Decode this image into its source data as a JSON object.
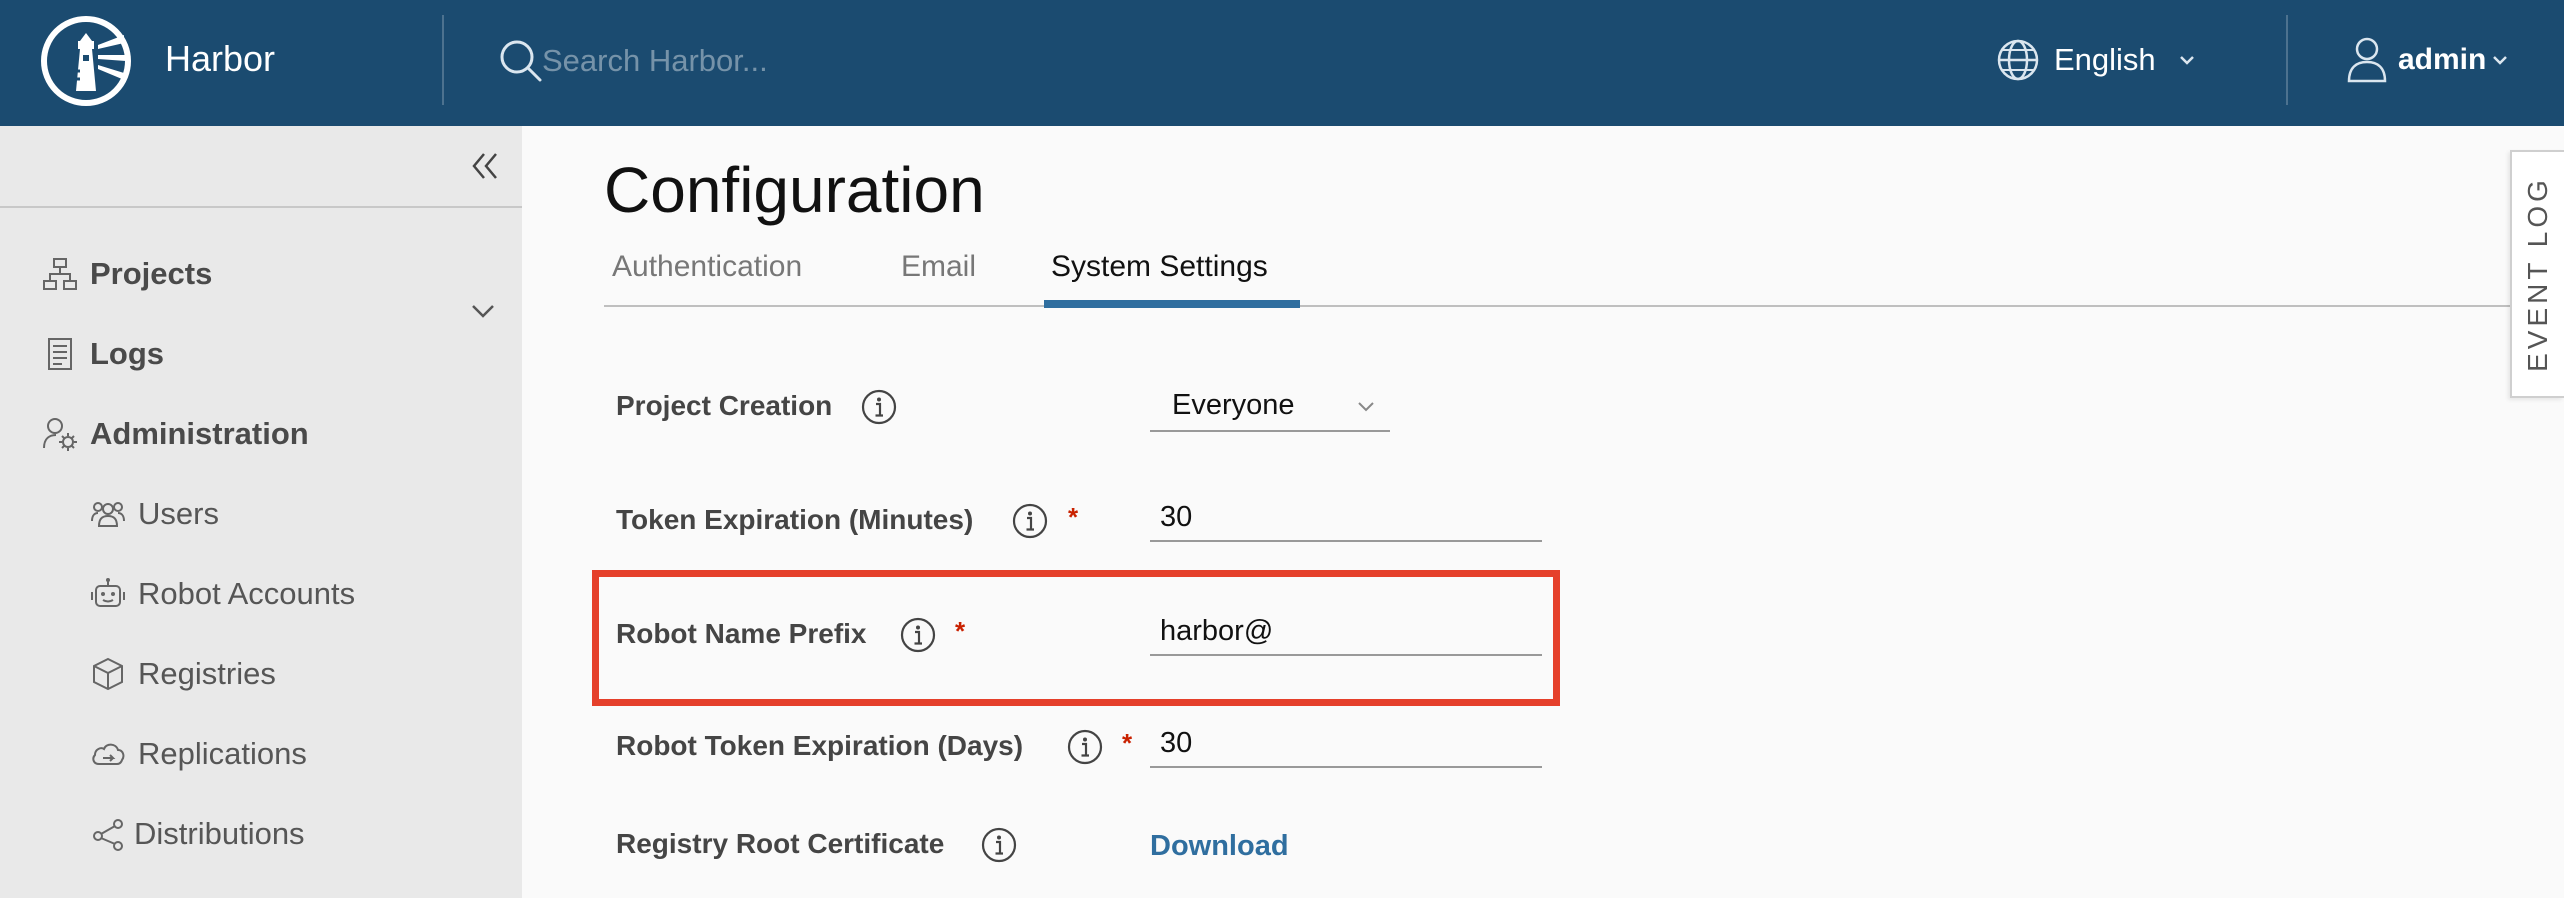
{
  "header": {
    "brand": "Harbor",
    "search_placeholder": "Search Harbor...",
    "language": "English",
    "user": "admin"
  },
  "sidebar": {
    "items": [
      {
        "label": "Projects",
        "icon": "projects-icon"
      },
      {
        "label": "Logs",
        "icon": "logs-icon"
      },
      {
        "label": "Administration",
        "icon": "administration-icon"
      },
      {
        "label": "Users",
        "icon": "users-icon"
      },
      {
        "label": "Robot Accounts",
        "icon": "robot-icon"
      },
      {
        "label": "Registries",
        "icon": "registries-icon"
      },
      {
        "label": "Replications",
        "icon": "replications-icon"
      },
      {
        "label": "Distributions",
        "icon": "distributions-icon"
      }
    ]
  },
  "page": {
    "title": "Configuration",
    "tabs": [
      {
        "label": "Authentication"
      },
      {
        "label": "Email"
      },
      {
        "label": "System Settings",
        "active": true
      }
    ]
  },
  "settings": {
    "project_creation": {
      "label": "Project Creation",
      "value": "Everyone"
    },
    "token_expiration": {
      "label": "Token Expiration (Minutes)",
      "value": "30",
      "required": "*"
    },
    "robot_name_prefix": {
      "label": "Robot Name Prefix",
      "value": "harbor@",
      "required": "*"
    },
    "robot_token_expiration": {
      "label": "Robot Token Expiration (Days)",
      "value": "30",
      "required": "*"
    },
    "registry_root_certificate": {
      "label": "Registry Root Certificate",
      "link": "Download"
    }
  },
  "event_log": "EVENT LOG",
  "colors": {
    "header_bg": "#1b4b70",
    "sidebar_bg": "#e9e9e9",
    "accent": "#2f6e9f",
    "highlight": "#e5402b",
    "required": "#c92100"
  }
}
